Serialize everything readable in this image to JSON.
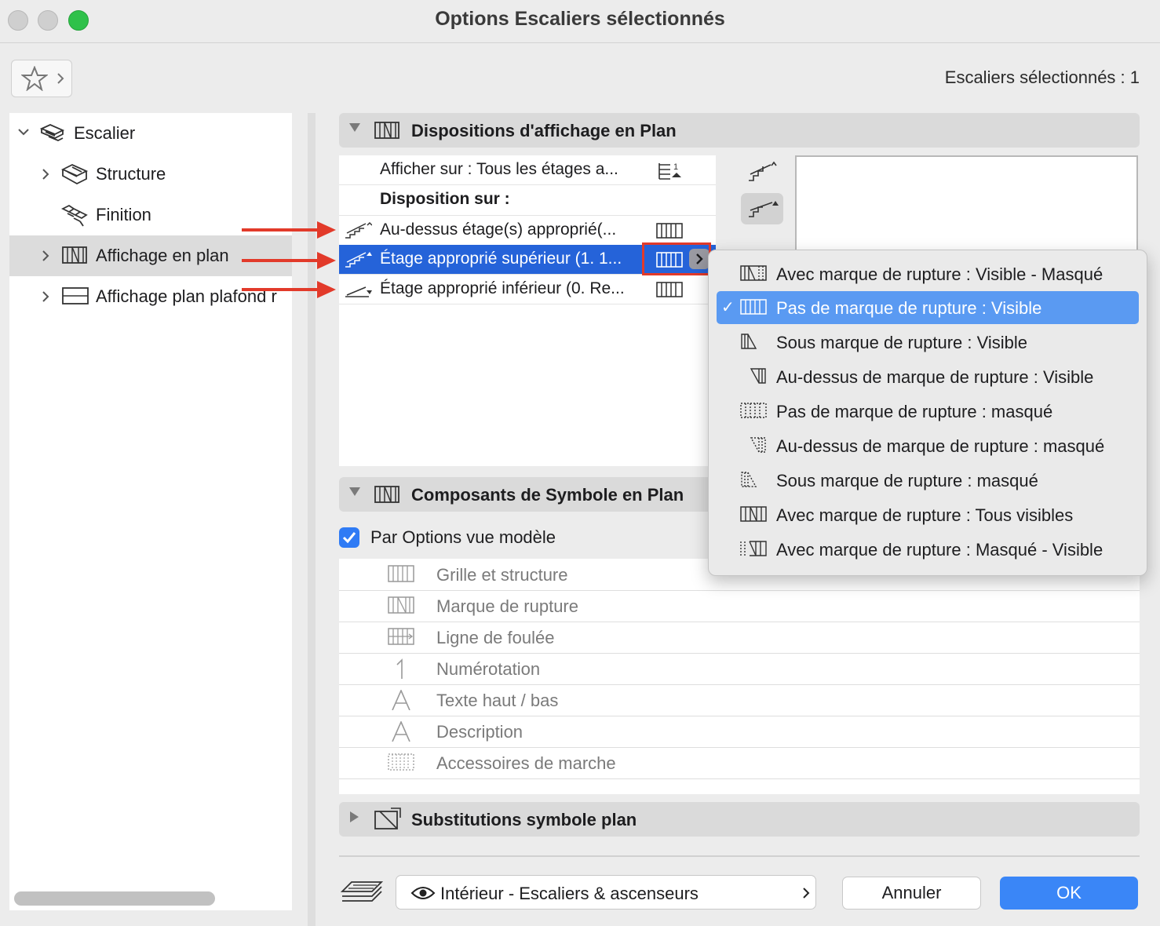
{
  "window": {
    "title": "Options Escaliers sélectionnés",
    "selection_count": "Escaliers sélectionnés : 1"
  },
  "tree": {
    "items": [
      {
        "label": "Escalier"
      },
      {
        "label": "Structure"
      },
      {
        "label": "Finition"
      },
      {
        "label": "Affichage en plan"
      },
      {
        "label": "Affichage plan plafond r"
      }
    ]
  },
  "section_display": {
    "title": "Dispositions d'affichage en Plan"
  },
  "display_list": {
    "show_on": "Afficher sur : Tous les étages a...",
    "disposition_header": "Disposition sur :",
    "rows": [
      {
        "label": "Au-dessus étage(s) approprié(..."
      },
      {
        "label": "Étage approprié supérieur (1. 1..."
      },
      {
        "label": "Étage approprié inférieur (0. Re..."
      }
    ]
  },
  "section_components": {
    "title": "Composants de Symbole en Plan"
  },
  "model_view_checkbox": {
    "label": "Par Options vue modèle",
    "checked": true
  },
  "components": [
    {
      "label": "Grille et structure"
    },
    {
      "label": "Marque de rupture"
    },
    {
      "label": "Ligne de foulée"
    },
    {
      "label": "Numérotation"
    },
    {
      "label": "Texte haut / bas"
    },
    {
      "label": "Description"
    },
    {
      "label": "Accessoires de marche"
    }
  ],
  "section_substitutions": {
    "title": "Substitutions symbole plan"
  },
  "footer": {
    "view_label": "Intérieur - Escaliers & ascenseurs",
    "cancel_label": "Annuler",
    "ok_label": "OK"
  },
  "popup_menu": {
    "selected_index": 1,
    "items": [
      {
        "label": "Avec marque de rupture : Visible - Masqué"
      },
      {
        "label": "Pas de marque de rupture : Visible"
      },
      {
        "label": "Sous marque de rupture : Visible"
      },
      {
        "label": "Au-dessus de marque de rupture : Visible"
      },
      {
        "label": "Pas de marque de rupture : masqué"
      },
      {
        "label": "Au-dessus de marque de rupture : masqué"
      },
      {
        "label": "Sous marque de rupture : masqué"
      },
      {
        "label": "Avec marque de rupture : Tous visibles"
      },
      {
        "label": "Avec marque de rupture : Masqué - Visible"
      }
    ]
  },
  "colors": {
    "accent": "#2563d9",
    "menu_highlight": "#5a9af2",
    "annotation_red": "#e23a2a",
    "ok_button": "#3a86f7"
  }
}
